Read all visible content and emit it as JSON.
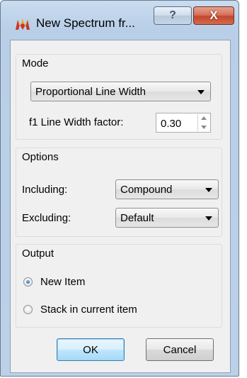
{
  "window": {
    "title": "New Spectrum fr...",
    "help_glyph": "?",
    "close_glyph": "X"
  },
  "mode": {
    "title": "Mode",
    "mode_select": {
      "selected": "Proportional Line Width"
    },
    "f1_label": "f1 Line Width factor:",
    "f1_value": "0.30"
  },
  "options": {
    "title": "Options",
    "including_label": "Including:",
    "including_value": "Compound",
    "excluding_label": "Excluding:",
    "excluding_value": "Default"
  },
  "output": {
    "title": "Output",
    "radios": [
      {
        "label": "New Item",
        "checked": true
      },
      {
        "label": "Stack in current item",
        "checked": false
      }
    ]
  },
  "buttons": {
    "ok_label": "OK",
    "cancel_label": "Cancel"
  },
  "colors": {
    "accent": "#3c7fb1",
    "close_button": "#c2482e"
  }
}
